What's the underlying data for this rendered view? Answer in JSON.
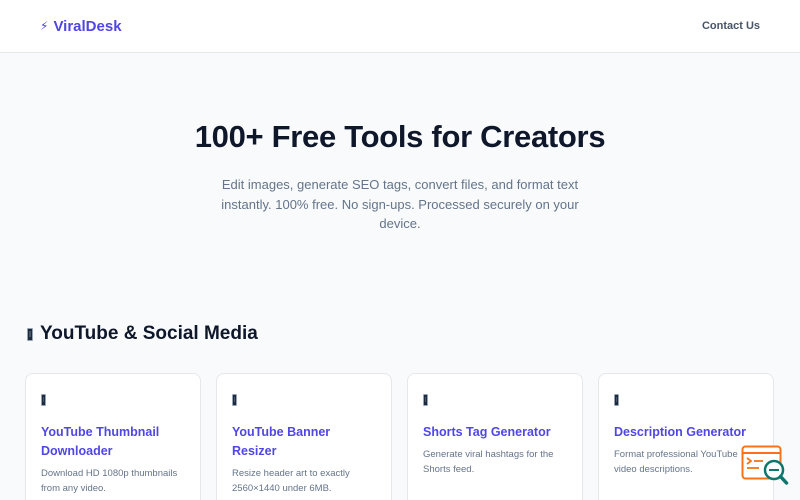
{
  "header": {
    "brand_icon": "⚡",
    "brand_name": "ViralDesk",
    "nav": {
      "contact": "Contact Us"
    }
  },
  "hero": {
    "title": "100+ Free Tools for Creators",
    "subtitle": "Edit images, generate SEO tags, convert files, and format text instantly. 100% free. No sign-ups. Processed securely on your device."
  },
  "section": {
    "icon": "phone-icon",
    "title": "YouTube & Social Media"
  },
  "cards": [
    {
      "icon": "phone-icon",
      "title": "YouTube Thumbnail Downloader",
      "desc": "Download HD 1080p thumbnails from any video."
    },
    {
      "icon": "phone-icon",
      "title": "YouTube Banner Resizer",
      "desc": "Resize header art to exactly 2560×1440 under 6MB."
    },
    {
      "icon": "phone-icon",
      "title": "Shorts Tag Generator",
      "desc": "Generate viral hashtags for the Shorts feed."
    },
    {
      "icon": "phone-icon",
      "title": "Description Generator",
      "desc": "Format professional YouTube video descriptions."
    }
  ],
  "floating_widget": {
    "icon": "search-list-icon"
  },
  "colors": {
    "accent": "#4f46e5",
    "heading": "#0f172a",
    "muted": "#64748b",
    "widget": "#f97316"
  }
}
